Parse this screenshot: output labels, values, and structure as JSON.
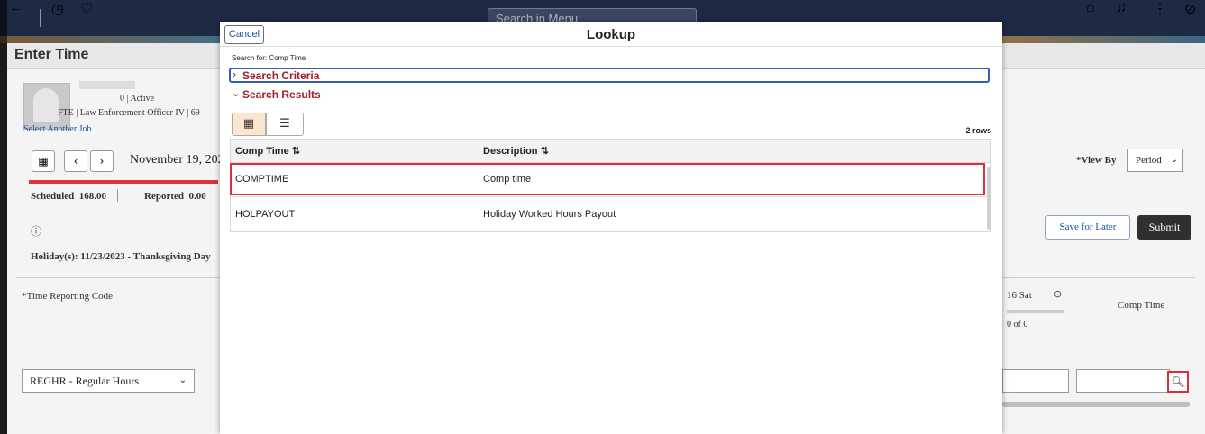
{
  "header": {
    "search_placeholder": "Search in Menu",
    "icons": [
      "back-arrow-icon",
      "history-icon",
      "favorite-icon",
      "home-icon",
      "notification-icon",
      "more-icon",
      "navigator-icon"
    ]
  },
  "page": {
    "title": "Enter Time",
    "employee": {
      "status": "0 | Active",
      "job": "FTE | Law Enforcement Officer IV | 69",
      "select_another_job": "Select Another Job"
    },
    "date": "November 19, 202",
    "scheduled_label": "Scheduled",
    "scheduled_value": "168.00",
    "reported_label": "Reported",
    "reported_value": "0.00",
    "holiday": "Holiday(s): 11/23/2023 - Thanksgiving Day",
    "view_by_label": "*View By",
    "view_by_value": "Period",
    "save_for_later": "Save for Later",
    "submit": "Submit",
    "trc_label": "*Time Reporting Code",
    "trc_value": "REGHR - Regular Hours",
    "day_label": "16 Sat",
    "day_progress": "0 of 0",
    "comp_time_header": "Comp Time"
  },
  "lookup": {
    "cancel_label": "Cancel",
    "title": "Lookup",
    "search_for": "Search for:  Comp Time",
    "search_criteria_label": "Search Criteria",
    "search_results_label": "Search Results",
    "rows_label": "2 rows",
    "columns": [
      "Comp Time ⇅",
      "Description ⇅"
    ],
    "rows": [
      [
        "COMPTIME",
        "Comp time"
      ],
      [
        "HOLPAYOUT",
        "Holiday Worked Hours Payout"
      ]
    ]
  },
  "colors": {
    "accent_red": "#d9303a",
    "section_label": "#a0212a",
    "focus_blue": "#2f5fb8",
    "header_bg": "#1d2a44"
  }
}
